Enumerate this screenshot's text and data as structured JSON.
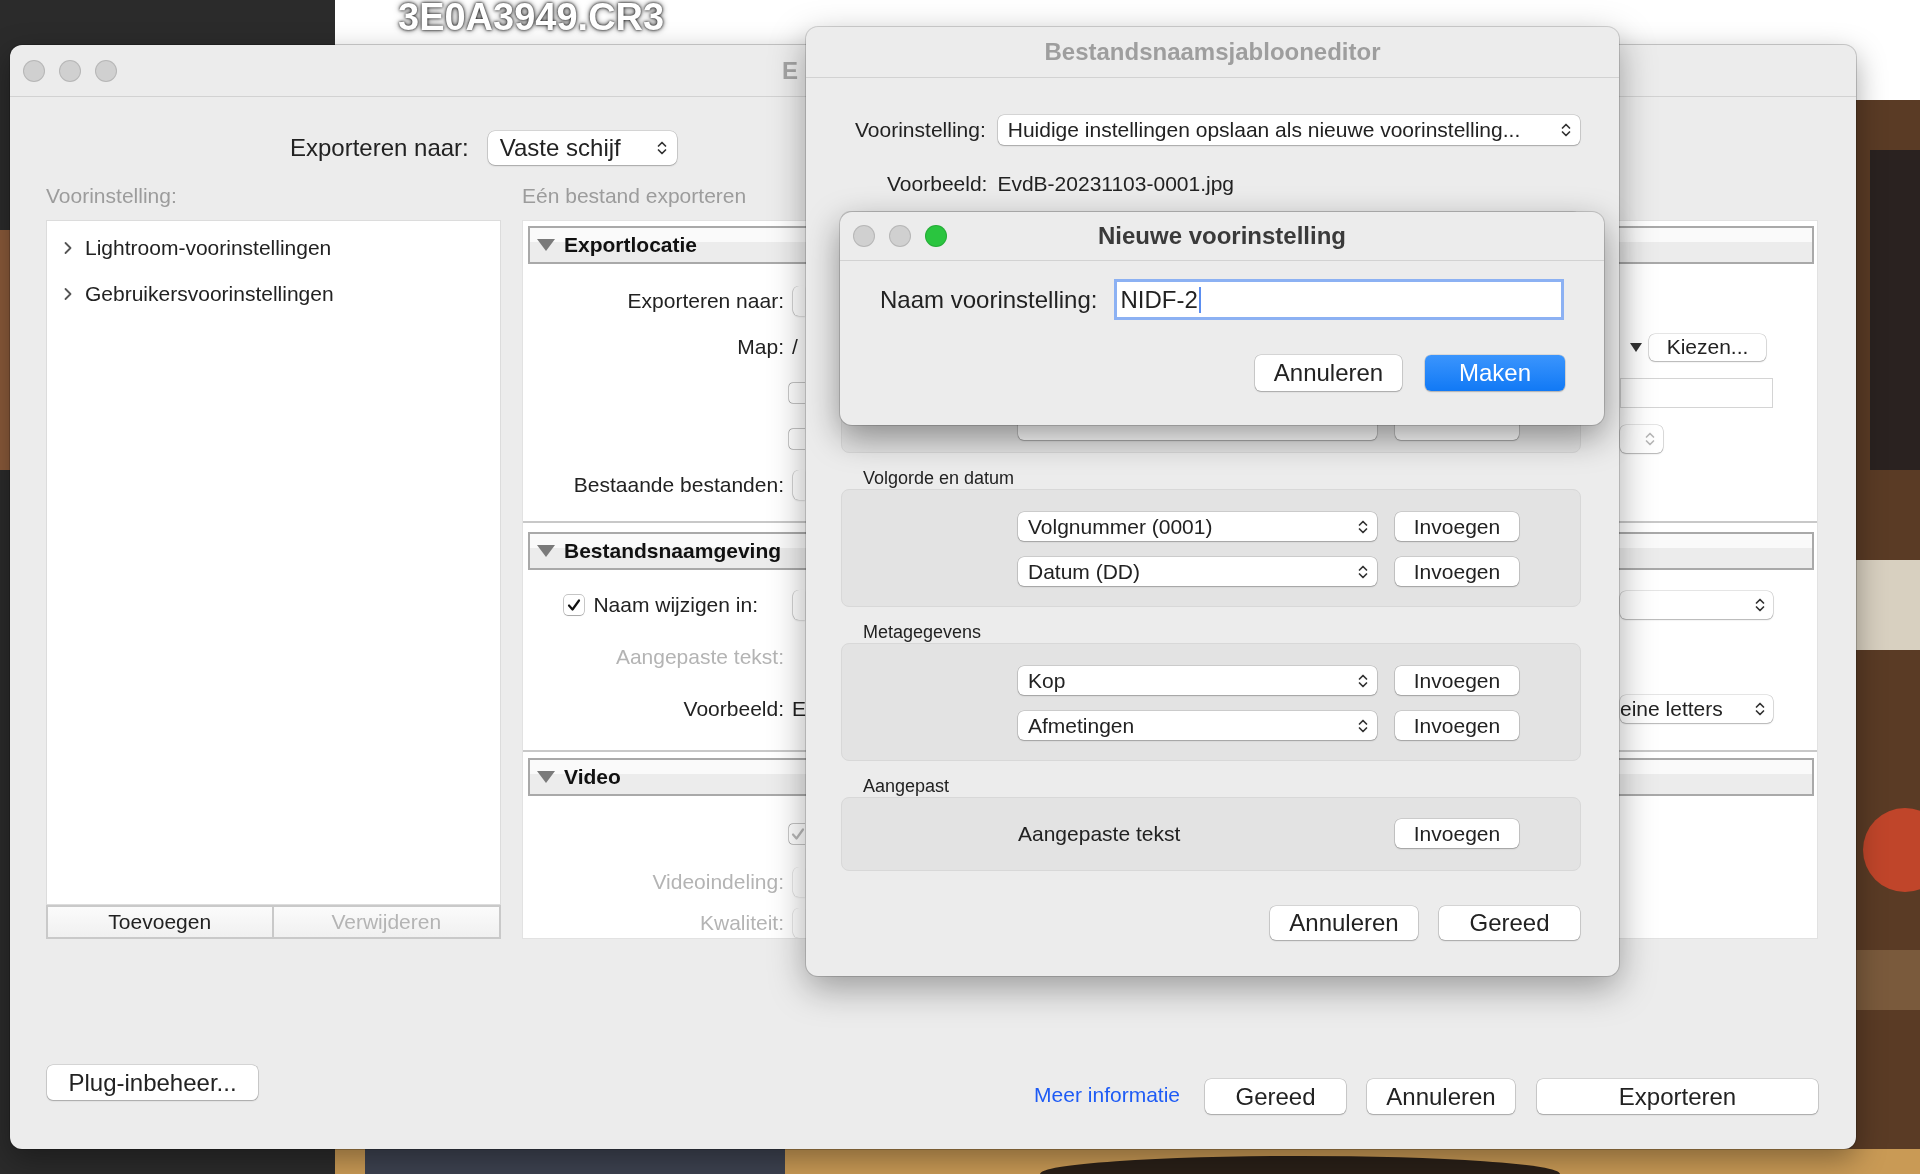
{
  "background": {
    "file_name": "3E0A3949.CR3"
  },
  "export_window": {
    "title": "E",
    "export_to": {
      "label": "Exporteren naar:",
      "value": "Vaste schijf"
    },
    "preset_label": "Voorinstelling:",
    "presets": [
      {
        "label": "Lightroom-voorinstellingen",
        "expanded": false
      },
      {
        "label": "Gebruikersvoorinstellingen",
        "expanded": false
      }
    ],
    "preset_buttons": [
      {
        "label": "Toevoegen",
        "disabled": false
      },
      {
        "label": "Verwijderen",
        "disabled": true
      }
    ],
    "subtitle": "Eén bestand exporteren",
    "sections": [
      {
        "title": "Exportlocatie",
        "expanded": true,
        "rows": [
          {
            "kind": "control",
            "label": "Exporteren naar:",
            "disabled": false
          },
          {
            "kind": "text",
            "label": "Map:",
            "value": "/",
            "disabled": false,
            "right": {
              "kind": "menu_button",
              "label": "Kiezen..."
            }
          },
          {
            "kind": "checkbox",
            "checked": false,
            "right": {
              "kind": "field"
            }
          },
          {
            "kind": "checkbox",
            "checked": false,
            "right": {
              "kind": "popup",
              "disabled": true
            }
          },
          {
            "kind": "control",
            "label": "Bestaande bestanden:",
            "disabled": false
          }
        ]
      },
      {
        "title": "Bestandsnaamgeving",
        "expanded": true,
        "rows": [
          {
            "kind": "check_label",
            "label": "Naam wijzigen in:",
            "checked": true,
            "disabled": false,
            "right": {
              "kind": "popup",
              "disabled": false
            }
          },
          {
            "kind": "label",
            "label": "Aangepaste tekst:",
            "disabled": true
          },
          {
            "kind": "text",
            "label": "Voorbeeld:",
            "value": "E",
            "disabled": false,
            "right": {
              "kind": "popup",
              "value": "eine letters",
              "disabled": false
            }
          }
        ]
      },
      {
        "title": "Video",
        "expanded": true,
        "rows": [
          {
            "kind": "checkbox",
            "checked": true,
            "disabled": true
          },
          {
            "kind": "control",
            "label": "Videoindeling:",
            "disabled": true
          },
          {
            "kind": "control",
            "label": "Kwaliteit:",
            "disabled": true
          }
        ]
      }
    ],
    "plugin_button": "Plug-inbeheer...",
    "more_info_link": "Meer informatie",
    "buttons": [
      "Gereed",
      "Annuleren",
      "Exporteren"
    ]
  },
  "template_editor": {
    "title": "Bestandsnaamsjablooneditor",
    "preset": {
      "label": "Voorinstelling:",
      "value": "Huidige instellingen opslaan als nieuwe voorinstelling..."
    },
    "preview": {
      "label": "Voorbeeld:",
      "value": "EvdB-20231103-0001.jpg"
    },
    "groups": [
      {
        "rows": [
          {
            "kind": "popup"
          }
        ]
      },
      {
        "title": "Volgorde en datum",
        "rows": [
          {
            "kind": "popup",
            "value": "Volgnummer (0001)",
            "button": "Invoegen"
          },
          {
            "kind": "popup",
            "value": "Datum (DD)",
            "button": "Invoegen"
          }
        ]
      },
      {
        "title": "Metagegevens",
        "rows": [
          {
            "kind": "popup",
            "value": "Kop",
            "button": "Invoegen"
          },
          {
            "kind": "popup",
            "value": "Afmetingen",
            "button": "Invoegen"
          }
        ]
      },
      {
        "title": "Aangepast",
        "rows": [
          {
            "kind": "text",
            "value": "Aangepaste tekst",
            "button": "Invoegen"
          }
        ]
      }
    ],
    "buttons": [
      {
        "label": "Annuleren",
        "default": false
      },
      {
        "label": "Gereed",
        "default": false
      }
    ]
  },
  "new_preset_dialog": {
    "title": "Nieuwe voorinstelling",
    "name_label": "Naam voorinstelling:",
    "name_value": "NIDF-2",
    "focused": true,
    "buttons": [
      {
        "label": "Annuleren",
        "default": false
      },
      {
        "label": "Maken",
        "default": true
      }
    ]
  }
}
